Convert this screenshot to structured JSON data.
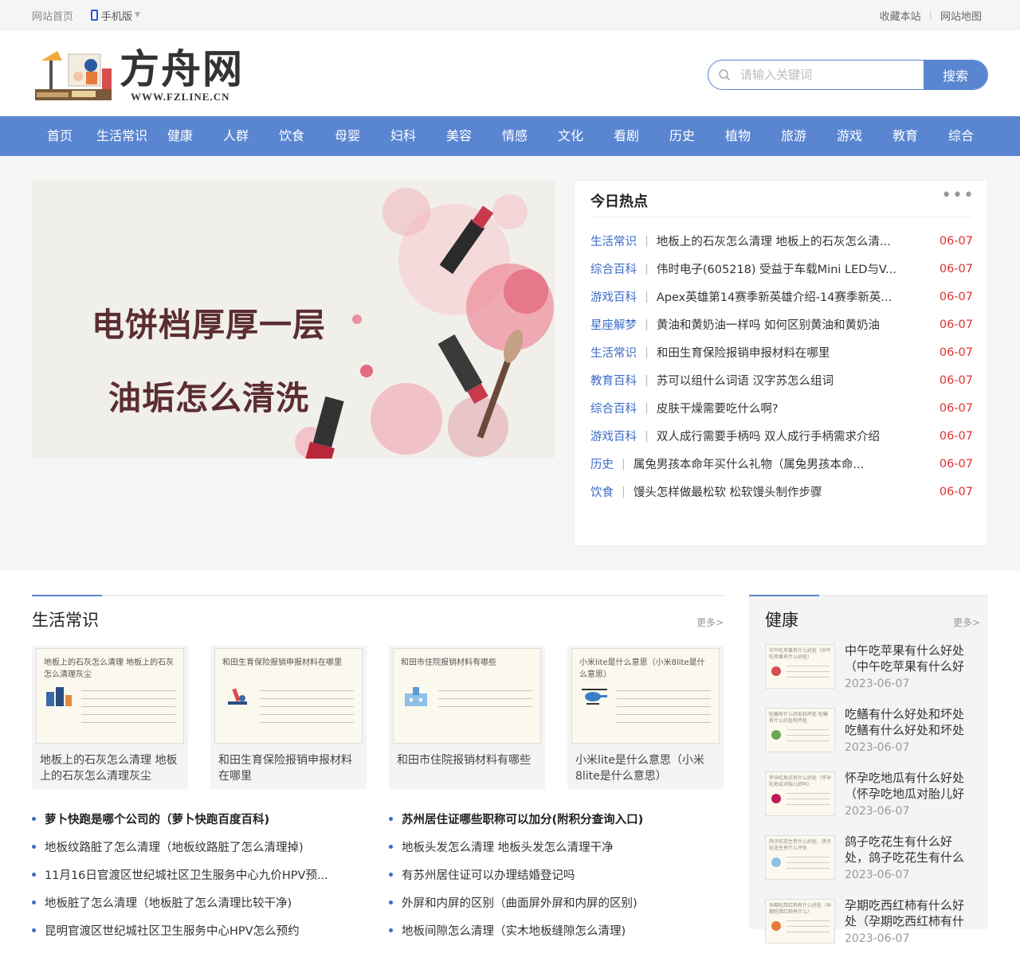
{
  "topbar": {
    "home": "网站首页",
    "mobile": "手机版",
    "favorite": "收藏本站",
    "sitemap": "网站地图"
  },
  "header": {
    "brand": "方舟网",
    "url": "WWW.FZLINE.CN",
    "search_placeholder": "请输入关键词",
    "search_button": "搜索"
  },
  "nav": [
    "首页",
    "生活常识",
    "健康",
    "人群",
    "饮食",
    "母婴",
    "妇科",
    "美容",
    "情感",
    "文化",
    "看剧",
    "历史",
    "植物",
    "旅游",
    "游戏",
    "教育",
    "综合"
  ],
  "banner": {
    "line1": "电饼档厚厚一层",
    "line2": "油垢怎么清洗"
  },
  "hot": {
    "title": "今日热点",
    "more": "•••",
    "items": [
      {
        "cat": "生活常识",
        "title": "地板上的石灰怎么清理 地板上的石灰怎么清...",
        "date": "06-07"
      },
      {
        "cat": "综合百科",
        "title": "伟时电子(605218) 受益于车载Mini LED与V...",
        "date": "06-07"
      },
      {
        "cat": "游戏百科",
        "title": "Apex英雄第14赛季新英雄介绍-14赛季新英...",
        "date": "06-07"
      },
      {
        "cat": "星座解梦",
        "title": "黄油和黄奶油一样吗 如何区别黄油和黄奶油",
        "date": "06-07"
      },
      {
        "cat": "生活常识",
        "title": "和田生育保险报销申报材料在哪里",
        "date": "06-07"
      },
      {
        "cat": "教育百科",
        "title": "苏可以组什么词语 汉字苏怎么组词",
        "date": "06-07"
      },
      {
        "cat": "综合百科",
        "title": "皮肤干燥需要吃什么啊?",
        "date": "06-07"
      },
      {
        "cat": "游戏百科",
        "title": "双人成行需要手柄吗 双人成行手柄需求介绍",
        "date": "06-07"
      },
      {
        "cat": "历史",
        "title": "属兔男孩本命年买什么礼物（属兔男孩本命...",
        "date": "06-07"
      },
      {
        "cat": "饮食",
        "title": "馒头怎样做最松软 松软馒头制作步骤",
        "date": "06-07"
      }
    ]
  },
  "life": {
    "title": "生活常识",
    "more": "更多>",
    "cards": [
      {
        "thumb": "地板上的石灰怎么清理 地板上的石灰怎么清理灰尘",
        "caption": "地板上的石灰怎么清理 地板上的石灰怎么清理灰尘"
      },
      {
        "thumb": "和田生育保险报销申报材料在哪里",
        "caption": "和田生育保险报销申报材料在哪里"
      },
      {
        "thumb": "和田市住院报销材料有哪些",
        "caption": "和田市住院报销材料有哪些"
      },
      {
        "thumb": "小米lite是什么意思（小米8lite是什么意思）",
        "caption": "小米lite是什么意思（小米8lite是什么意思）"
      }
    ],
    "left_list": [
      "萝卜快跑是哪个公司的（萝卜快跑百度百科)",
      "地板纹路脏了怎么清理（地板纹路脏了怎么清理掉)",
      "11月16日官渡区世纪城社区卫生服务中心九价HPV预...",
      "地板脏了怎么清理（地板脏了怎么清理比较干净)",
      "昆明官渡区世纪城社区卫生服务中心HPV怎么预约"
    ],
    "right_list": [
      "苏州居住证哪些职称可以加分(附积分查询入口)",
      "地板头发怎么清理 地板头发怎么清理干净",
      "有苏州居住证可以办理结婚登记吗",
      "外屏和内屏的区别（曲面屏外屏和内屏的区别)",
      "地板间隙怎么清理（实木地板缝隙怎么清理)"
    ]
  },
  "health": {
    "title": "健康",
    "more": "更多>",
    "items": [
      {
        "thumb": "中午吃苹果有什么好处（中午吃苹果有什么好处）",
        "title": "中午吃苹果有什么好处（中午吃苹果有什么好",
        "date": "2023-06-07"
      },
      {
        "thumb": "吃鳝有什么好处和坏处 吃鳝有什么好处和坏处",
        "title": "吃鳝有什么好处和坏处 吃鳝有什么好处和坏处",
        "date": "2023-06-07"
      },
      {
        "thumb": "怀孕吃地瓜有什么好处（怀孕吃地瓜对胎儿好吗）",
        "title": "怀孕吃地瓜有什么好处（怀孕吃地瓜对胎儿好",
        "date": "2023-06-07"
      },
      {
        "thumb": "鸽子吃花生有什么好处，鸽子吃花生有什么坏处",
        "title": "鸽子吃花生有什么好处，鸽子吃花生有什么",
        "date": "2023-06-07"
      },
      {
        "thumb": "孕期吃西红柿有什么好处（孕期吃西红柿有什么）",
        "title": "孕期吃西红柿有什么好处（孕期吃西红柿有什",
        "date": "2023-06-07"
      }
    ]
  }
}
